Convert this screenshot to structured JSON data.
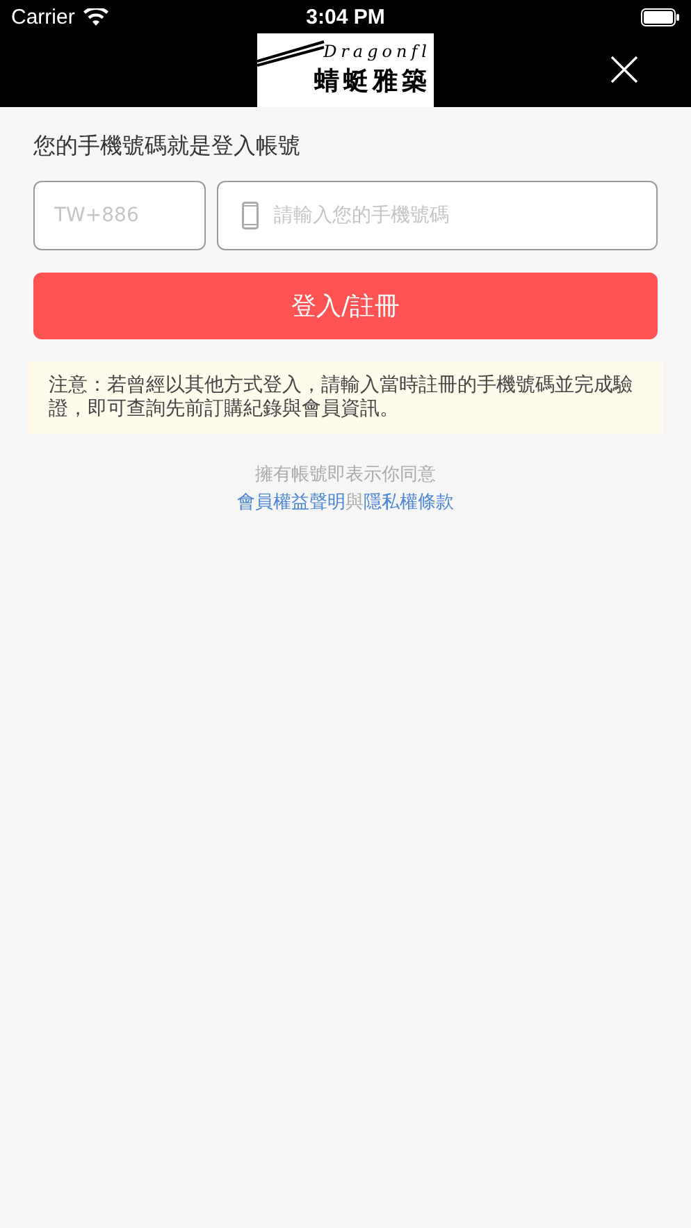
{
  "status_bar": {
    "carrier": "Carrier",
    "time": "3:04 PM"
  },
  "nav": {
    "logo_latin": "Dragonfl",
    "logo_chinese": "蜻蜓雅築"
  },
  "heading": "您的手機號碼就是登入帳號",
  "country_field": {
    "placeholder": "TW+886"
  },
  "phone_field": {
    "placeholder": "請輸入您的手機號碼"
  },
  "submit_button": "登入/註冊",
  "notice": "注意：若曾經以其他方式登入，請輸入當時註冊的手機號碼並完成驗證，即可查詢先前訂購紀錄與會員資訊。",
  "agreement": {
    "line": "擁有帳號即表示你同意",
    "parts": [
      {
        "kind": "link",
        "text": "會員權益聲明"
      },
      {
        "kind": "plain",
        "text": "與"
      },
      {
        "kind": "link",
        "text": "隱私權條款"
      }
    ]
  }
}
